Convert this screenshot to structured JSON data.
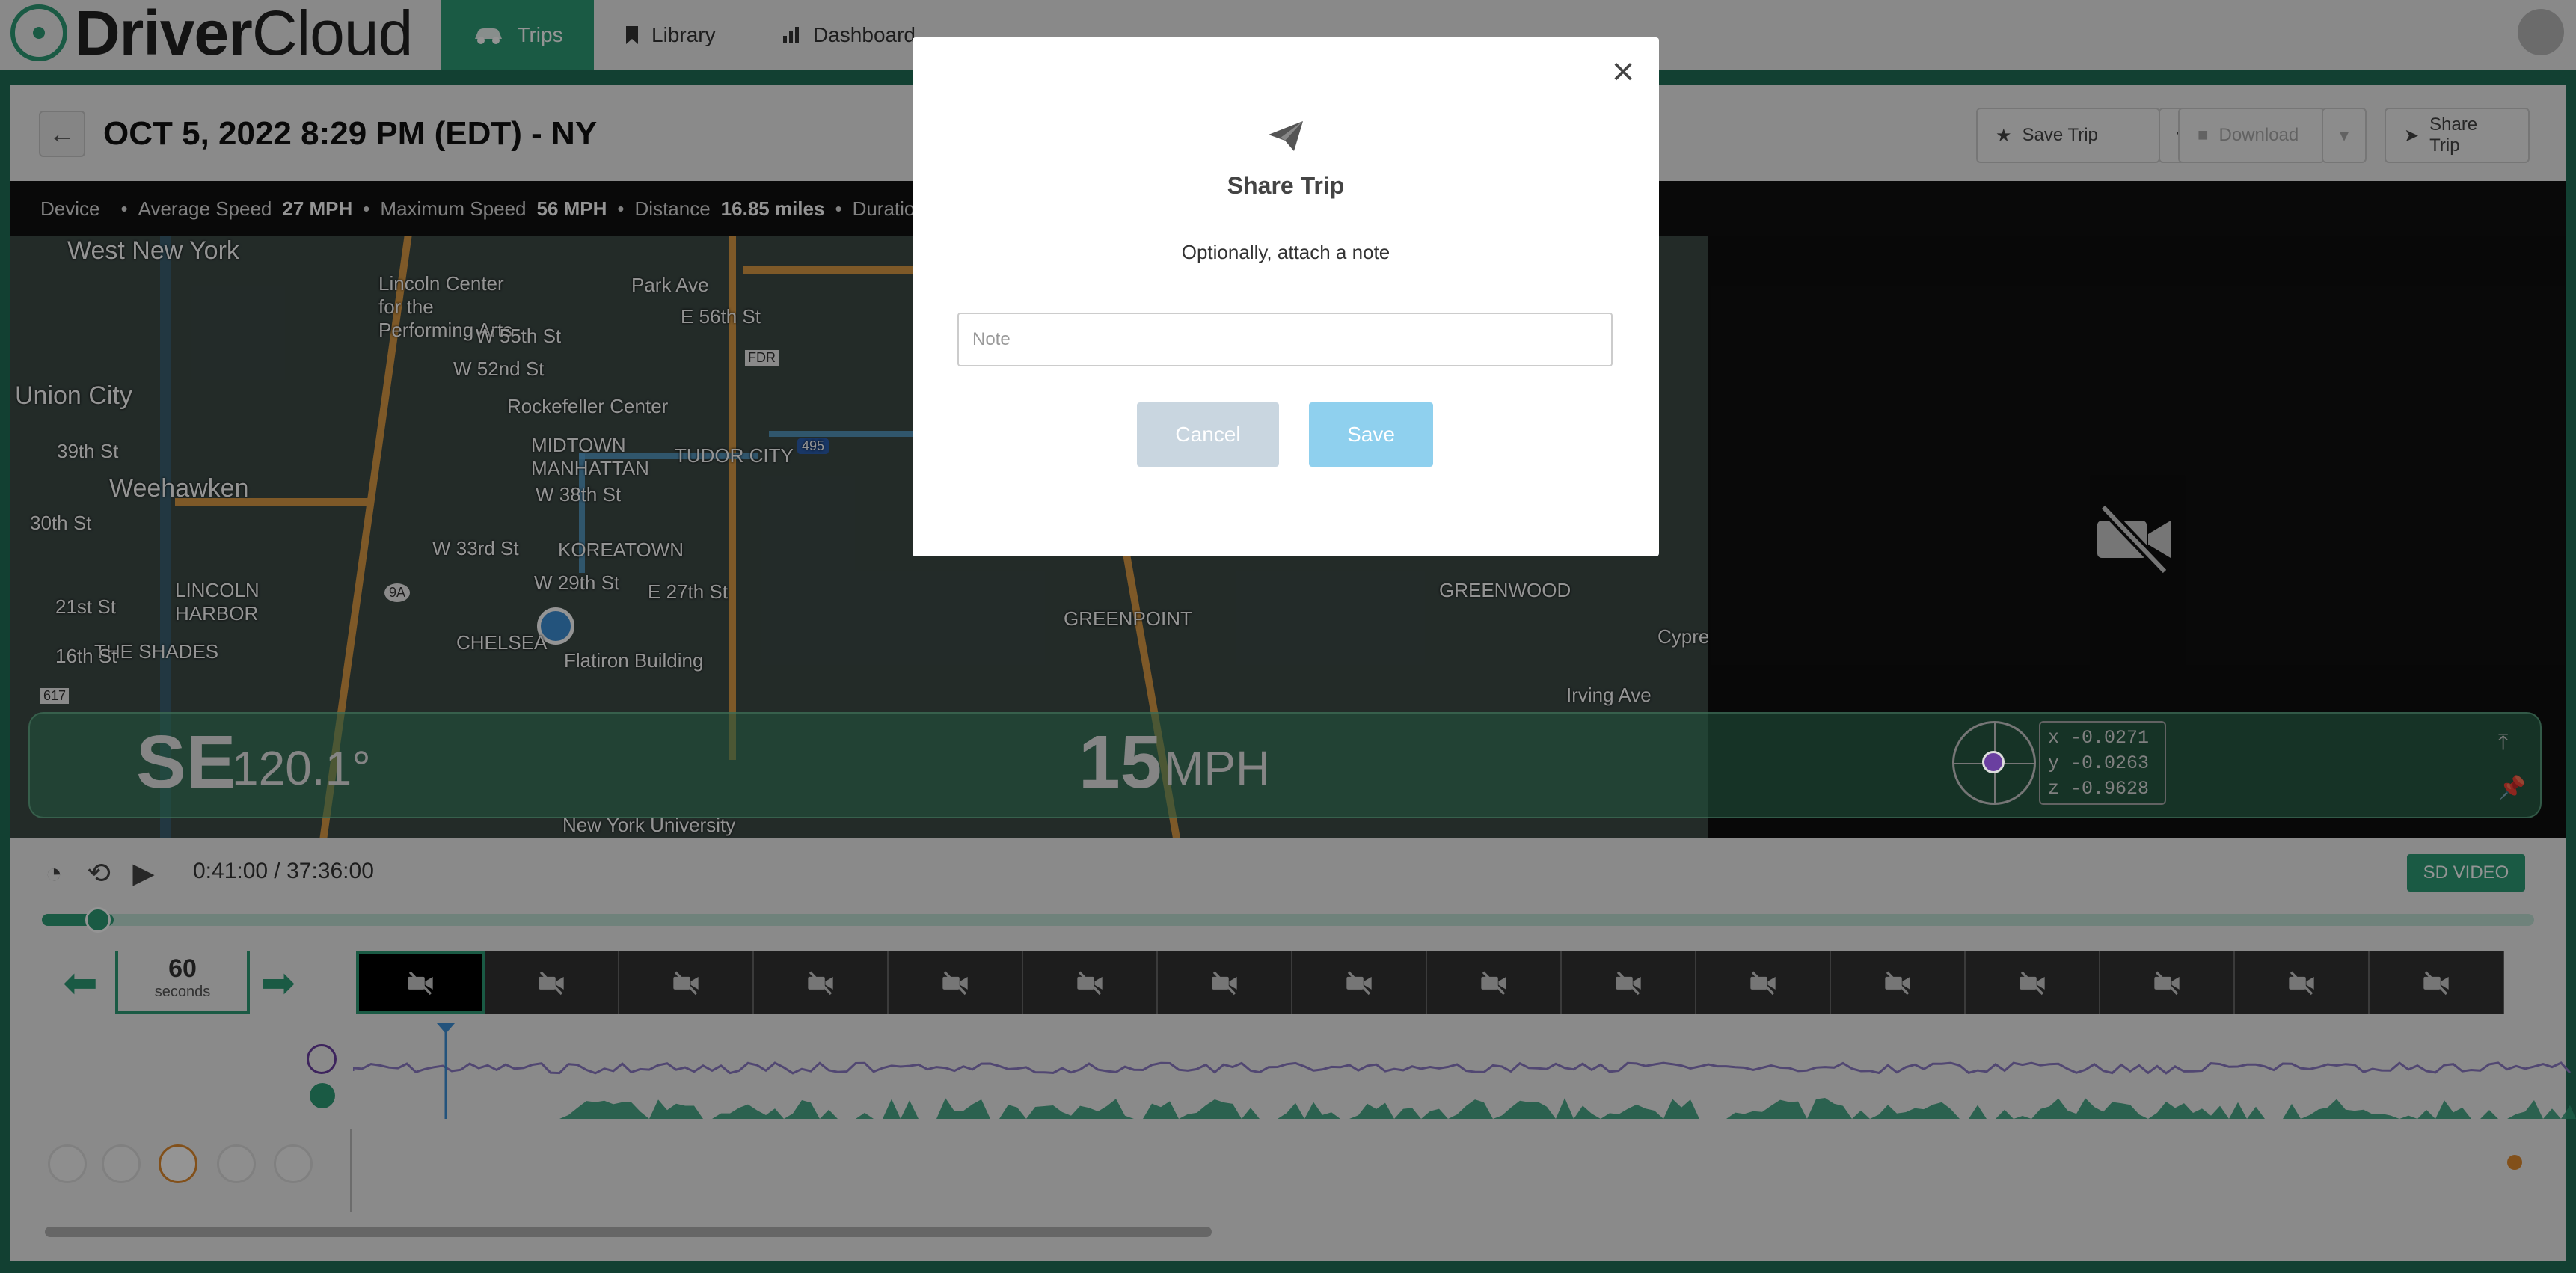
{
  "app": {
    "name_bold": "Driver",
    "name_light": "Cloud"
  },
  "nav": {
    "tabs": [
      {
        "label": "Trips",
        "icon": "car-icon",
        "active": true
      },
      {
        "label": "Library",
        "icon": "bookmark-icon"
      },
      {
        "label": "Dashboard",
        "icon": "bar-chart-icon"
      }
    ]
  },
  "trip": {
    "title": "OCT 5, 2022 8:29 PM (EDT) - NY",
    "actions": {
      "save": "Save Trip",
      "download": "Download",
      "share": "Share Trip"
    }
  },
  "stats": {
    "device_label": "Device",
    "avg_speed_label": "Average Speed",
    "avg_speed": "27 MPH",
    "max_speed_label": "Maximum Speed",
    "max_speed": "56 MPH",
    "distance_label": "Distance",
    "distance": "16.85 miles",
    "duration_label": "Duration"
  },
  "map": {
    "labels": [
      "West New York",
      "Union City",
      "Weehawken",
      "Lincoln Center for the Performing Arts",
      "Rockefeller Center",
      "MIDTOWN MANHATTAN",
      "KOREATOWN",
      "CHELSEA",
      "Flatiron Building",
      "LINCOLN HARBOR",
      "THE SHADES",
      "TUDOR CITY",
      "GREENPOINT",
      "GREENWOOD",
      "New York University",
      "W 55th St",
      "W 52nd St",
      "W 38th St",
      "W 33rd St",
      "W 29th St",
      "E 27th St",
      "E 56th St",
      "Park Ave",
      "30th St",
      "39th St",
      "21st St",
      "16th St",
      "FDR",
      "495",
      "9A",
      "617",
      "Irving Ave",
      "Cypress"
    ]
  },
  "hud": {
    "heading_dir": "SE",
    "heading_deg": "120.1°",
    "speed": "15",
    "speed_unit": "MPH",
    "gx": "x -0.0271",
    "gy": "y -0.0263",
    "gz": "z -0.9628"
  },
  "playback": {
    "timecode": "0:41:00 / 37:36:00",
    "quality_badge": "SD VIDEO",
    "progress": 0.0011,
    "interval_value": "60",
    "interval_unit": "seconds",
    "thumbnail_count": 16
  },
  "modal": {
    "title": "Share Trip",
    "subtitle": "Optionally, attach a note",
    "note_placeholder": "Note",
    "note_value": "",
    "cancel": "Cancel",
    "save": "Save"
  },
  "colors": {
    "brand": "#2e9b76",
    "save_button": "#8fd0ee",
    "cancel_button": "#c9d6e0"
  }
}
